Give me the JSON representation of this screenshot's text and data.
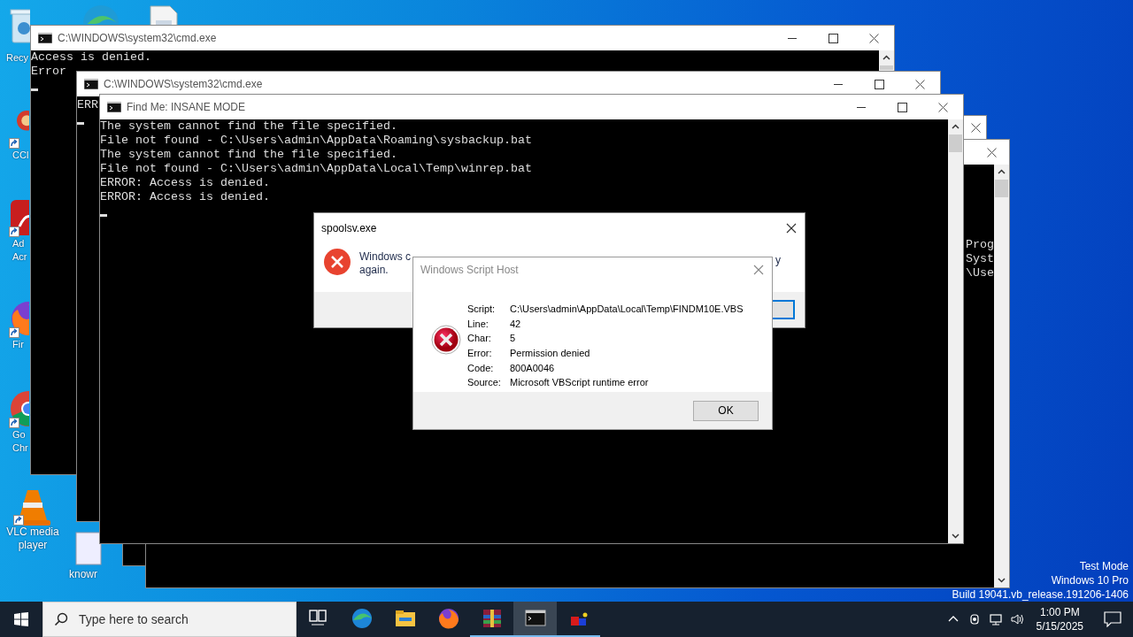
{
  "desktop": {
    "icons": [
      {
        "kind": "recycle",
        "label": [
          "Recy"
        ],
        "shortcut": false
      },
      {
        "kind": "edge",
        "shortcut": false
      },
      {
        "kind": "file",
        "shortcut": false
      },
      {
        "kind": "ccleaner",
        "label": [
          "CCl"
        ],
        "shortcut": true
      },
      {
        "kind": "acrobat",
        "label": [
          "Ad",
          "Acr"
        ],
        "shortcut": true
      },
      {
        "kind": "firefox",
        "label": [
          "Fir"
        ],
        "shortcut": true
      },
      {
        "kind": "chrome",
        "label": [
          "Go",
          "Chr"
        ],
        "shortcut": true
      },
      {
        "kind": "vlc",
        "label": [
          "VLC media",
          "player"
        ],
        "shortcut": true
      },
      {
        "kind": "blank",
        "label": [
          "knowr"
        ],
        "shortcut": false
      }
    ],
    "os_notice": [
      "Test Mode",
      "Windows 10 Pro",
      "Build 19041.vb_release.191206-1406"
    ]
  },
  "windows": [
    {
      "kind": "console",
      "title": "C:\\WINDOWS\\system32\\cmd.exe",
      "buttons": [
        {
          "kind": "minimize"
        },
        {
          "kind": "maximize"
        },
        {
          "kind": "close"
        }
      ],
      "lines": [
        "Access is denied.",
        "Error"
      ],
      "cursor": true
    },
    {
      "kind": "console",
      "title": "C:\\WINDOWS\\system32\\cmd.exe",
      "buttons": [
        {
          "kind": "minimize"
        },
        {
          "kind": "maximize"
        },
        {
          "kind": "close"
        }
      ],
      "lines": [
        "ERR"
      ],
      "cursor": true
    },
    {
      "kind": "console-edge",
      "buttons": [
        {
          "kind": "close"
        }
      ]
    },
    {
      "kind": "console-edge",
      "buttons": [
        {
          "kind": "close"
        }
      ],
      "lines": [
        "Prog",
        "Syst",
        "\\Use"
      ]
    },
    {
      "kind": "console",
      "title": "Find Me: INSANE MODE",
      "buttons": [
        {
          "kind": "minimize"
        },
        {
          "kind": "maximize"
        },
        {
          "kind": "close"
        }
      ],
      "lines": [
        "The system cannot find the file specified.",
        "File not found - C:\\Users\\admin\\AppData\\Roaming\\sysbackup.bat",
        "The system cannot find the file specified.",
        "File not found - C:\\Users\\admin\\AppData\\Local\\Temp\\winrep.bat",
        "ERROR: Access is denied.",
        "ERROR: Access is denied."
      ],
      "cursor": true
    }
  ],
  "message_box": {
    "title": "spoolsv.exe",
    "message": [
      "Windows c",
      "again."
    ],
    "fragment": "y"
  },
  "script_error": {
    "title": "Windows Script Host",
    "fields": [
      {
        "label": "Script:",
        "value": "C:\\Users\\admin\\AppData\\Local\\Temp\\FINDM10E.VBS"
      },
      {
        "label": "Line:",
        "value": "42"
      },
      {
        "label": "Char:",
        "value": "5"
      },
      {
        "label": "Error:",
        "value": "Permission denied"
      },
      {
        "label": "Code:",
        "value": "800A0046"
      },
      {
        "label": "Source:",
        "value": "Microsoft VBScript runtime error"
      }
    ],
    "button": "OK"
  },
  "taskbar": {
    "search": {
      "placeholder": "Type here to search"
    },
    "apps": [
      {
        "kind": "taskview",
        "running": false,
        "selected": false
      },
      {
        "kind": "edge",
        "running": false,
        "selected": false
      },
      {
        "kind": "explorer",
        "running": false,
        "selected": false
      },
      {
        "kind": "firefox",
        "running": false,
        "selected": false
      },
      {
        "kind": "winrar",
        "running": true,
        "selected": false
      },
      {
        "kind": "cmd",
        "running": true,
        "selected": true
      },
      {
        "kind": "app",
        "running": true,
        "selected": false
      }
    ],
    "time": "1:00 PM",
    "date": "5/15/2025"
  }
}
